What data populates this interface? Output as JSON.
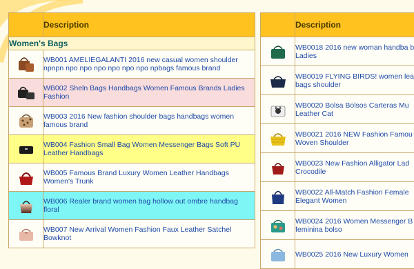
{
  "colors": {
    "header_bg": "#ffc21f",
    "highlight_pink": "#f9dcdc",
    "highlight_yellow": "#ffff88",
    "highlight_cyan": "#7ef6f6",
    "link_text": "#1e4aa8"
  },
  "left_table": {
    "header": "Description",
    "section": "Women's Bags",
    "items": [
      {
        "text": "WB001 AMELIEGALANTI 2016 new casual women shoulder npnpn npo npo npo npo npo npo npbags famous brand",
        "thumb": "brown-bag-set-icon",
        "highlight": "none"
      },
      {
        "text": "WB002 Sheln Bags Handbags Women Famous Brands Ladies Fashion",
        "thumb": "black-bag-set-icon",
        "highlight": "pink"
      },
      {
        "text": "WB003 2016 New fashion shoulder bags handbags women famous brand",
        "thumb": "leopard-bag-icon",
        "highlight": "none"
      },
      {
        "text": "WB004 Fashion Small Bag Women Messenger Bags Soft PU Leather Handbags",
        "thumb": "black-clutch-icon",
        "highlight": "yellow"
      },
      {
        "text": "WB005 Famous Brand Luxury Women Leather Handbags Women's Trunk",
        "thumb": "red-handbag-icon",
        "highlight": "none"
      },
      {
        "text": "WB006 Realer brand women bag hollow out ombre handbag floral",
        "thumb": "ombre-bag-icon",
        "highlight": "cyan"
      },
      {
        "text": "WB007 New Arrival Women Fashion Faux Leather Satchel Bowknot",
        "thumb": "pink-satchel-icon",
        "highlight": "none"
      }
    ]
  },
  "right_table": {
    "header": "Description",
    "items": [
      {
        "text": "WB0018 2016 new woman handba bag Ladies",
        "thumb": "green-bag-icon"
      },
      {
        "text": "WB0019 FLYING BIRDS! women lea bags shoulder",
        "thumb": "navy-bag-icon"
      },
      {
        "text": "WB0020 Bolsa Bolsos Carteras Mu Leather Cat",
        "thumb": "cat-bag-icon"
      },
      {
        "text": "WB0021 2016 NEW Fashion Famou Woven Shoulder",
        "thumb": "yellow-woven-bag-icon"
      },
      {
        "text": "WB0023 New Fashion Alligator Lad Crocodile",
        "thumb": "red-croc-bag-icon"
      },
      {
        "text": "WB0022 All-Match Fashion Female Elegant Women",
        "thumb": "blue-tote-icon"
      },
      {
        "text": "WB0024 2016 Women Messenger B feminina bolso",
        "thumb": "teal-floral-bag-icon"
      },
      {
        "text": "WB0025 2016 New Luxury Women",
        "thumb": "light-blue-bag-icon"
      }
    ]
  }
}
